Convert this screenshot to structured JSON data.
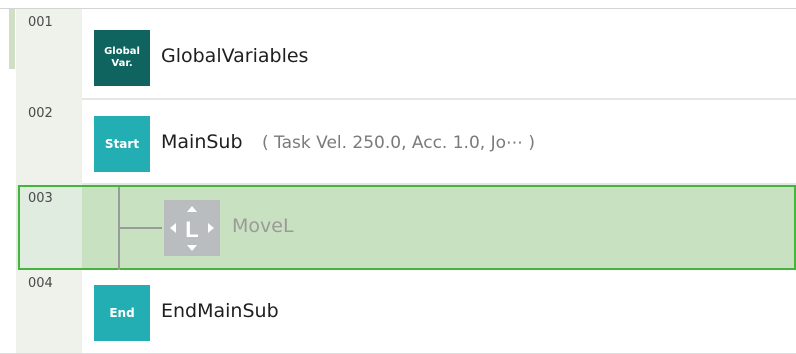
{
  "rows": [
    {
      "number": "001",
      "badge_line1": "Global",
      "badge_line2": "Var.",
      "label": "GlobalVariables"
    },
    {
      "number": "002",
      "badge": "Start",
      "label": "MainSub",
      "params": "( Task Vel. 250.0, Acc. 1.0, Jo⋯ )"
    },
    {
      "number": "003",
      "icon": "move-linear-icon",
      "icon_letter": "L",
      "label": "MoveL"
    },
    {
      "number": "004",
      "badge": "End",
      "label": "EndMainSub"
    }
  ],
  "colors": {
    "global_badge": "#10645f",
    "start_end_badge": "#22aeb2",
    "selection_border": "#44b53a",
    "selection_fill": "#c8e1c1",
    "disabled_icon": "#b9bdc0"
  }
}
